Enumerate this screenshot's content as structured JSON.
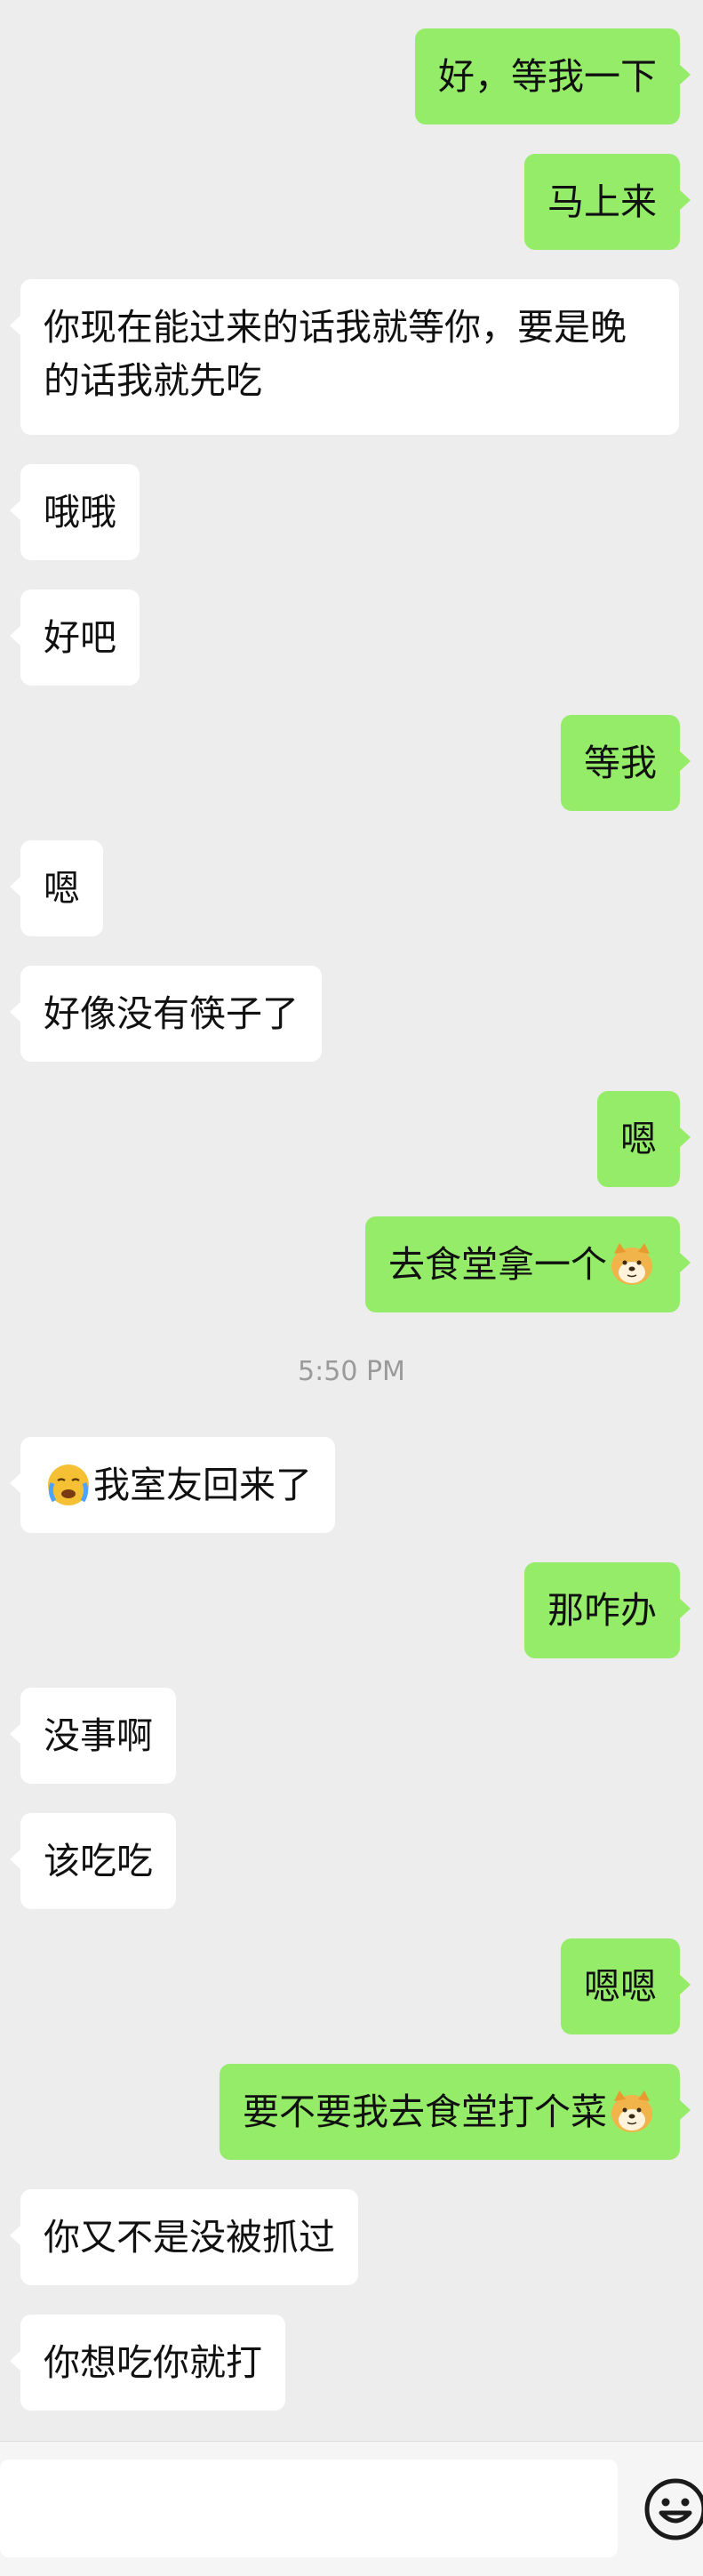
{
  "messages": [
    {
      "side": "out",
      "text": "好，等我一下"
    },
    {
      "side": "out",
      "text": "马上来"
    },
    {
      "side": "in",
      "text": "你现在能过来的话我就等你，要是晚的话我就先吃"
    },
    {
      "side": "in",
      "text": "哦哦"
    },
    {
      "side": "in",
      "text": "好吧"
    },
    {
      "side": "out",
      "text": "等我"
    },
    {
      "side": "in",
      "text": "嗯"
    },
    {
      "side": "in",
      "text": "好像没有筷子了"
    },
    {
      "side": "out",
      "text": "嗯"
    },
    {
      "side": "out",
      "text": "去食堂拿一个",
      "emoji_after": "doge-emoji"
    },
    {
      "side": "in",
      "text": "我室友回来了",
      "emoji_before": "crying-face-emoji"
    },
    {
      "side": "out",
      "text": "那咋办"
    },
    {
      "side": "in",
      "text": "没事啊"
    },
    {
      "side": "in",
      "text": "该吃吃"
    },
    {
      "side": "out",
      "text": "嗯嗯"
    },
    {
      "side": "out",
      "text": "要不要我去食堂打个菜",
      "emoji_after": "doge-emoji"
    },
    {
      "side": "in",
      "text": "你又不是没被抓过"
    },
    {
      "side": "in",
      "text": "你想吃你就打"
    }
  ],
  "timestamp": "5:50 PM",
  "input_bar": {
    "message_value": "",
    "emoji_button_icon": "smiley-face-icon"
  },
  "colors": {
    "background": "#ededed",
    "incoming_bubble": "#ffffff",
    "outgoing_bubble": "#95ec69",
    "timestamp_text": "#9a9a9a"
  }
}
